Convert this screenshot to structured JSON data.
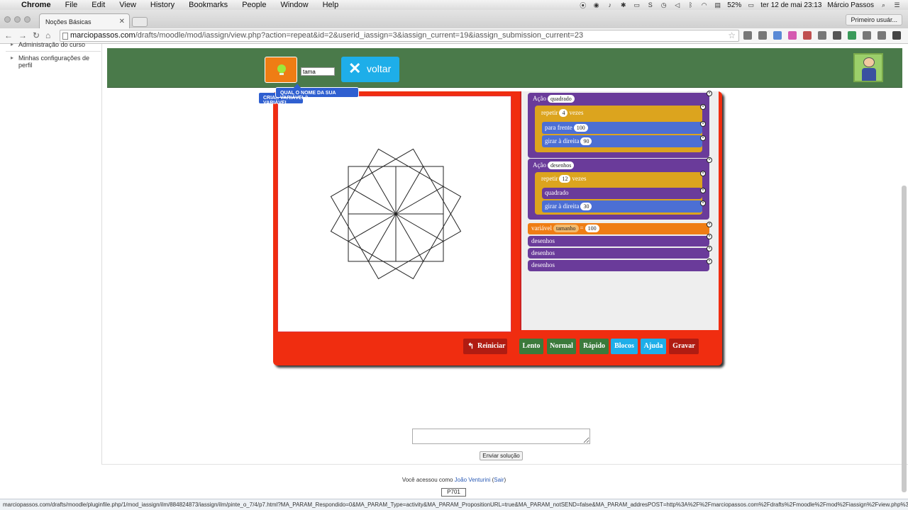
{
  "menubar": {
    "app": "Chrome",
    "items": [
      "File",
      "Edit",
      "View",
      "History",
      "Bookmarks",
      "People",
      "Window",
      "Help"
    ],
    "battery": "52%",
    "datetime": "ter 12 de mai  23:13",
    "user": "Márcio Passos"
  },
  "tabs": [
    {
      "title": "Noções Básicas"
    }
  ],
  "profile_button": "Primeiro usuár...",
  "address": {
    "host": "marciopassos.com",
    "path": "/drafts/moodle/mod/iassign/view.php?action=repeat&id=2&userid_iassign=3&iassign_current=19&iassign_submission_current=23"
  },
  "leftnav": {
    "items": [
      "Administração do curso",
      "Minhas configurações de perfil"
    ]
  },
  "activity": {
    "variable_input": "tama",
    "voltar_label": "voltar",
    "tooltip": "QUAL O NOME DA SUA VARIÁVEL?",
    "criar_label": "CRIAR VARIÁVEL"
  },
  "blocks": {
    "acao1_label": "Ação",
    "acao1_name": "quadrado",
    "repetir1_label": "repetir",
    "repetir1_count": "4",
    "vezes1": "vezes",
    "para_frente_label": "para frente",
    "para_frente_value": "100",
    "girar1_label": "girar à direita",
    "girar1_value": "90",
    "acao2_label": "Ação",
    "acao2_name": "desenhos",
    "repetir2_label": "repetir",
    "repetir2_count": "12",
    "vezes2": "vezes",
    "quadrado_call": "quadrado",
    "girar2_label": "girar à direita",
    "girar2_value": "30",
    "variavel_label": "variável",
    "variavel_name": "tamanho",
    "variavel_eq": "=",
    "variavel_value": "100",
    "desenhos_calls": [
      "desenhos",
      "desenhos",
      "desenhos"
    ]
  },
  "buttons": {
    "reiniciar": "Reiniciar",
    "lento": "Lento",
    "normal": "Normal",
    "rapido": "Rápido",
    "blocos": "Blocos",
    "ajuda": "Ajuda",
    "gravar": "Gravar"
  },
  "submission": {
    "submit_label": "Enviar solução"
  },
  "footer": {
    "prefix": "Você acessou como",
    "user": "João Venturini",
    "logout": "Sair",
    "code": "P701"
  },
  "statusbar": "marciopassos.com/drafts/moodle/pluginfile.php/1/mod_iassign/ilm/884824873/iassign/ilm/pinte_o_7/4/p7.html?MA_PARAM_Respondido=0&MA_PARAM_Type=activity&MA_PARAM_PropositionURL=true&MA_PARAM_notSEND=false&MA_PARAM_addresPOST=http%3A%2F%2Fmarciopassos.com%2Fdrafts%2Fmoodle%2Fmod%2Fiassign%2Fview.php%3Facti..."
}
